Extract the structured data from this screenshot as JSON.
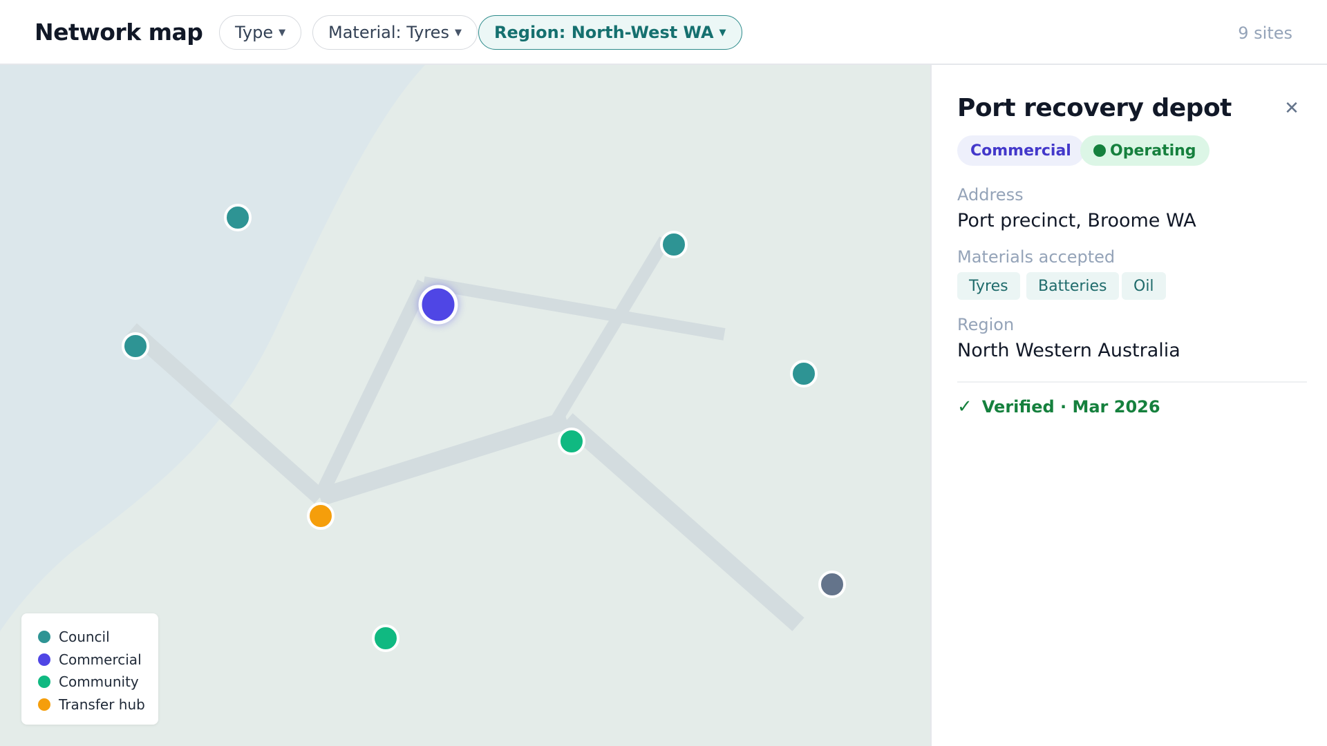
{
  "header": {
    "title": "Network map",
    "filters": [
      {
        "label": "Type",
        "active": false
      },
      {
        "label": "Material: Tyres",
        "active": false
      },
      {
        "label": "Region: North-West WA",
        "active": true
      }
    ],
    "count": "9 sites"
  },
  "colors": {
    "council": "#2e9494",
    "commercial": "#4f46e5",
    "community": "#10b981",
    "transfer_hub": "#f59e0b",
    "inactive": "#64748b",
    "route": "#d3dcdf",
    "water": "#dce7eb",
    "land": "#e4ece9"
  },
  "legend": [
    {
      "label": "Council",
      "color": "#2e9494"
    },
    {
      "label": "Commercial",
      "color": "#4f46e5"
    },
    {
      "label": "Community",
      "color": "#10b981"
    },
    {
      "label": "Transfer hub",
      "color": "#f59e0b"
    }
  ],
  "sites": [
    {
      "type": "council",
      "selected": false
    },
    {
      "type": "council",
      "selected": false
    },
    {
      "type": "commercial",
      "selected": true
    },
    {
      "type": "council",
      "selected": false
    },
    {
      "type": "council",
      "selected": false
    },
    {
      "type": "community",
      "selected": false
    },
    {
      "type": "transfer_hub",
      "selected": false
    },
    {
      "type": "community",
      "selected": false
    },
    {
      "type": "inactive",
      "selected": false
    }
  ],
  "panel": {
    "title": "Port recovery depot",
    "close_icon": "close-icon",
    "type_badge": "Commercial",
    "status_badge": "Operating",
    "address_label": "Address",
    "address": "Port precinct, Broome WA",
    "materials_label": "Materials accepted",
    "materials": [
      "Tyres",
      "Batteries",
      "Oil"
    ],
    "region_label": "Region",
    "region": "North Western Australia",
    "check_icon": "check-icon",
    "verified": "Verified · Mar 2026"
  }
}
